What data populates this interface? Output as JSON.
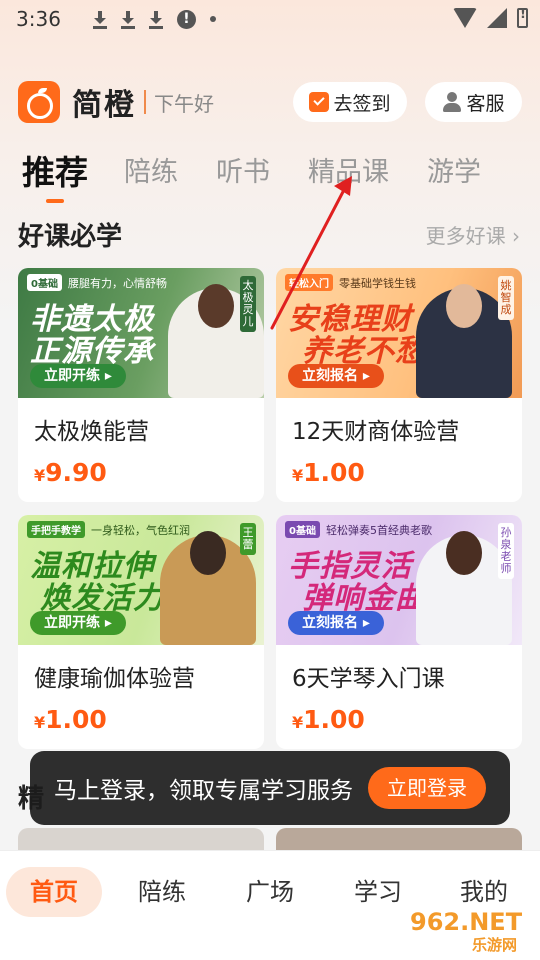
{
  "status_bar": {
    "time": "3:36"
  },
  "header": {
    "app_name": "简橙",
    "greeting": "下午好",
    "checkin_label": "去签到",
    "service_label": "客服"
  },
  "tabs": [
    {
      "label": "推荐",
      "active": true
    },
    {
      "label": "陪练",
      "active": false
    },
    {
      "label": "听书",
      "active": false
    },
    {
      "label": "精品课",
      "active": false
    },
    {
      "label": "游学",
      "active": false
    }
  ],
  "section": {
    "title": "好课必学",
    "more_label": "更多好课 ›"
  },
  "courses": [
    {
      "name": "太极焕能营",
      "price": "9.90",
      "currency": "¥",
      "banner": {
        "chip": "0基础",
        "tagline": "腰腿有力，心情舒畅",
        "line1": "非遗太极",
        "line2": "正源传承",
        "cta": "立即开练 ▸",
        "teacher": "太极灵儿"
      }
    },
    {
      "name": "12天财商体验营",
      "price": "1.00",
      "currency": "¥",
      "banner": {
        "chip": "轻松入门",
        "tagline": "零基础学钱生钱",
        "line1": "安稳理财",
        "line2": "养老不愁",
        "cta": "立刻报名 ▸",
        "teacher": "姚智成"
      }
    },
    {
      "name": "健康瑜伽体验营",
      "price": "1.00",
      "currency": "¥",
      "banner": {
        "chip": "手把手教学",
        "tagline": "一身轻松，气色红润",
        "line1": "温和拉伸",
        "line2": "焕发活力",
        "cta": "立即开练 ▸",
        "teacher": "王蕾"
      }
    },
    {
      "name": "6天学琴入门课",
      "price": "1.00",
      "currency": "¥",
      "banner": {
        "chip": "0基础",
        "tagline": "轻松弹奏5首经典老歌",
        "line1": "手指灵活",
        "line2": "弹响金曲",
        "cta": "立刻报名 ▸",
        "teacher": "孙泉老师"
      }
    }
  ],
  "peek_title": "精",
  "login_toast": {
    "text": "马上登录，领取专属学习服务",
    "button": "立即登录"
  },
  "bottom_nav": [
    {
      "label": "首页",
      "active": true
    },
    {
      "label": "陪练",
      "active": false
    },
    {
      "label": "广场",
      "active": false
    },
    {
      "label": "学习",
      "active": false
    },
    {
      "label": "我的",
      "active": false
    }
  ],
  "watermark": {
    "line1": "962.NET",
    "line2": "乐游网"
  },
  "colors": {
    "accent": "#ff6a1a",
    "price": "#ff5a12",
    "annotation_arrow": "#e02020"
  }
}
